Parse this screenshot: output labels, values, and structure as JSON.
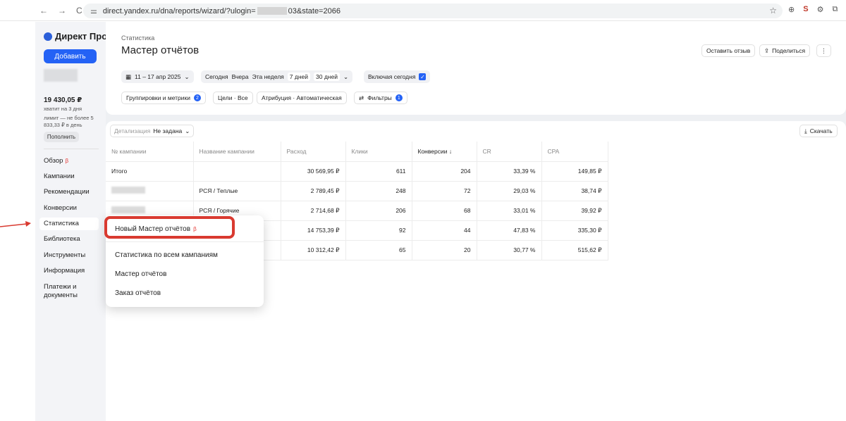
{
  "browser": {
    "url_prefix": "direct.yandex.ru/dna/reports/wizard/?ulogin=",
    "url_suffix": "03&state=2066",
    "nav_back": "←",
    "nav_forward": "→",
    "nav_reload": "C"
  },
  "sidebar": {
    "logo": "Директ Про",
    "add_button": "Добавить",
    "balance": "19 430,05 ₽",
    "balance_note": "хватит на 3 дня",
    "limit_note": "лимит — не более 5 833,33 ₽ в день",
    "refill_button": "Пополнить",
    "items": [
      {
        "label": "Обзор",
        "beta": "β"
      },
      {
        "label": "Кампании"
      },
      {
        "label": "Рекомендации"
      },
      {
        "label": "Конверсии"
      },
      {
        "label": "Статистика"
      },
      {
        "label": "Библиотека"
      },
      {
        "label": "Инструменты"
      },
      {
        "label": "Информация"
      },
      {
        "label": "Платежи и документы"
      }
    ]
  },
  "header": {
    "breadcrumb": "Статистика",
    "title": "Мастер отчётов",
    "feedback_button": "Оставить отзыв",
    "share_button": "Поделиться",
    "more_button": "⋮"
  },
  "filters": {
    "date_range": "11 – 17 апр 2025",
    "today": "Сегодня",
    "yesterday": "Вчера",
    "this_week": "Эта неделя",
    "days7": "7 дней",
    "days30": "30 дней",
    "include_today": "Включая сегодня",
    "grouping": "Группировки и метрики",
    "grouping_count": "2",
    "goals": "Цели · Все",
    "attribution": "Атрибуция · Автоматическая",
    "filters_label": "Фильтры",
    "filters_count": "1"
  },
  "table_controls": {
    "detail_label": "Детализация",
    "detail_value": "Не задана",
    "download": "Скачать"
  },
  "table": {
    "headers": [
      "№ кампании",
      "Название кампании",
      "Расход",
      "Клики",
      "Конверсии ↓",
      "CR",
      "CPA"
    ],
    "total": {
      "label": "Итого",
      "name": "",
      "spend": "30 569,95 ₽",
      "clicks": "611",
      "conv": "204",
      "cr": "33,39 %",
      "cpa": "149,85 ₽"
    },
    "rows": [
      {
        "name": "РСЯ / Теплые",
        "spend": "2 789,45 ₽",
        "clicks": "248",
        "conv": "72",
        "cr": "29,03 %",
        "cpa": "38,74 ₽"
      },
      {
        "name": "РСЯ / Горячие",
        "spend": "2 714,68 ₽",
        "clicks": "206",
        "conv": "68",
        "cr": "33,01 %",
        "cpa": "39,92 ₽"
      },
      {
        "name": "",
        "spend": "14 753,39 ₽",
        "clicks": "92",
        "conv": "44",
        "cr": "47,83 %",
        "cpa": "335,30 ₽"
      },
      {
        "name": "",
        "spend": "10 312,42 ₽",
        "clicks": "65",
        "conv": "20",
        "cr": "30,77 %",
        "cpa": "515,62 ₽"
      }
    ]
  },
  "menu": {
    "new_wizard": "Новый Мастер отчётов",
    "new_wizard_beta": "β",
    "all_campaigns": "Статистика по всем кампаниям",
    "wizard": "Мастер отчётов",
    "order": "Заказ отчётов"
  },
  "colors": {
    "accent": "#2462f5",
    "highlight": "#d93a30",
    "beta": "#e53935"
  }
}
